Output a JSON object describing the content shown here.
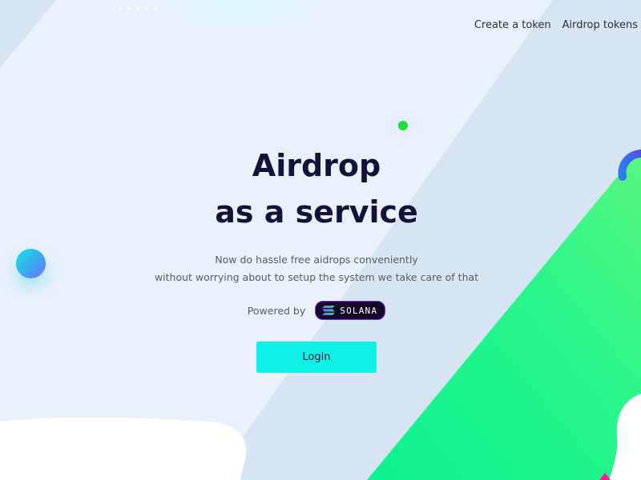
{
  "nav": {
    "items": [
      {
        "label": "Create a token"
      },
      {
        "label": "Airdrop tokens"
      }
    ]
  },
  "hero": {
    "title_line1": "Airdrop",
    "title_line2": "as a service",
    "subtitle_line1": "Now do hassle free aidrops conveniently",
    "subtitle_line2": "without worrying about to setup the system we take care of that",
    "powered_by": "Powered by",
    "solana_badge": "SOLANA",
    "login_label": "Login"
  },
  "colors": {
    "accent": "#0ff0e6",
    "heading": "#15123a",
    "green_shape": "#1cf58c",
    "green_dot": "#16e23a"
  }
}
